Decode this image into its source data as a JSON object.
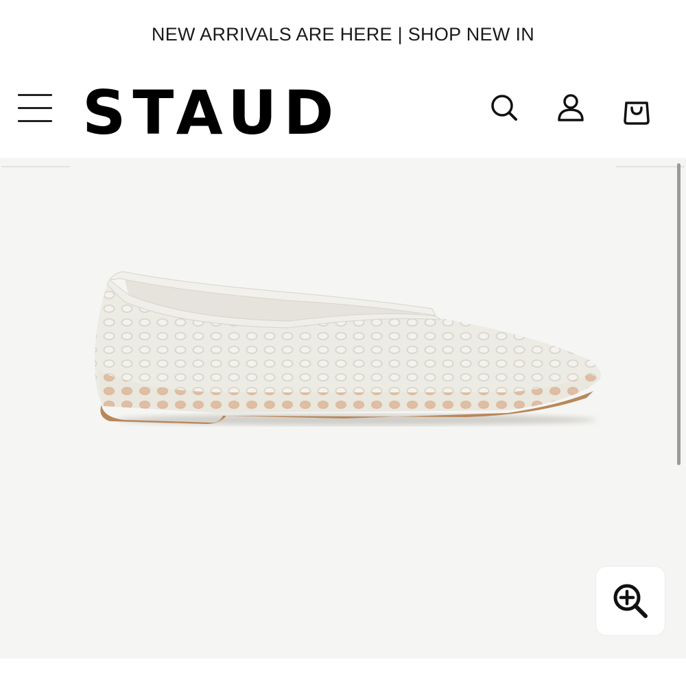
{
  "announcement": "NEW ARRIVALS ARE HERE | SHOP NEW IN",
  "header": {
    "logo": "STAUD",
    "icons": {
      "menu": "hamburger-icon",
      "search": "search-icon",
      "account": "user-icon",
      "bag": "shopping-bag-icon"
    }
  },
  "gallery": {
    "image": "white-mesh-ballet-flat",
    "zoom_icon": "zoom-in-icon"
  },
  "colors": {
    "gallery_bg": "#f5f5f3",
    "mesh": "#ecebe4",
    "sole": "#b8875a"
  }
}
